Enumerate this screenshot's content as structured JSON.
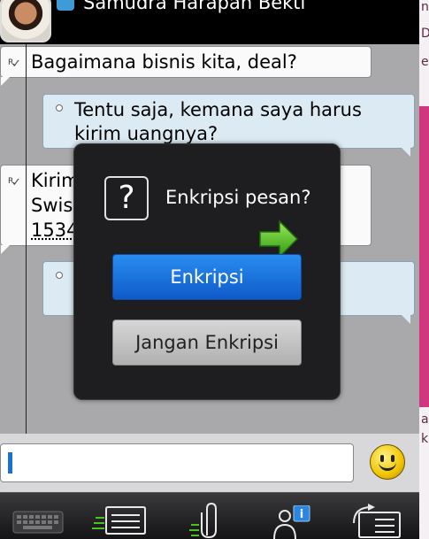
{
  "header": {
    "contact_name": "Samudra Harapan Bekti"
  },
  "messages": [
    {
      "direction": "incoming",
      "status": "R",
      "text": "Bagaimana bisnis kita, deal?"
    },
    {
      "direction": "outgoing",
      "text_line1": "Tentu saja, kemana saya harus",
      "text_line2": "kirim uangnya?"
    },
    {
      "direction": "incoming",
      "status": "R",
      "text_line1": "Kirim",
      "text_line2": "Swis",
      "text_line3": "1534"
    },
    {
      "direction": "outgoing",
      "text": ""
    }
  ],
  "dialog": {
    "title": "Enkripsi pesan?",
    "primary_label": "Enkripsi",
    "secondary_label": "Jangan Enkripsi"
  },
  "side_strip": {
    "top_chars": "nf",
    "mid_chars": "D",
    "mid2_chars": "e",
    "bottom_chars": "a",
    "bottom2_chars": "k"
  },
  "input": {
    "value": ""
  },
  "toolbar": {
    "items": [
      "keyboard-icon",
      "conversation-icon",
      "attach-icon",
      "contact-info-icon",
      "switch-chat-icon"
    ]
  },
  "colors": {
    "primary_button": "#1565d8",
    "accent_pink": "#d0377e",
    "arrow_green": "#4cc21f"
  }
}
